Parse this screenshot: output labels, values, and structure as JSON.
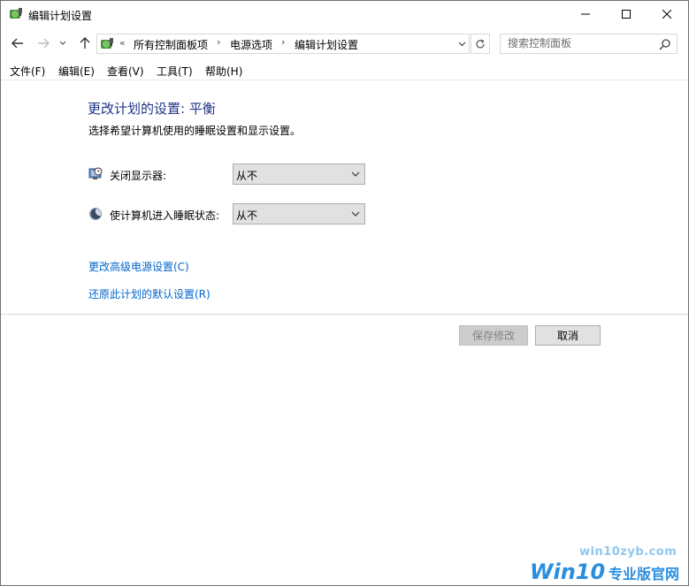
{
  "window": {
    "title": "编辑计划设置"
  },
  "address": {
    "overflow": "«",
    "crumbs": [
      "所有控制面板项",
      "电源选项",
      "编辑计划设置"
    ],
    "separator": "›"
  },
  "search": {
    "placeholder": "搜索控制面板"
  },
  "menu": {
    "file": "文件(F)",
    "edit": "编辑(E)",
    "view": "查看(V)",
    "tools": "工具(T)",
    "help": "帮助(H)"
  },
  "content": {
    "title": "更改计划的设置: 平衡",
    "description": "选择希望计算机使用的睡眠设置和显示设置。",
    "settings": [
      {
        "label": "关闭显示器:",
        "value": "从不",
        "icon": "monitor-clock-icon"
      },
      {
        "label": "使计算机进入睡眠状态:",
        "value": "从不",
        "icon": "moon-icon"
      }
    ],
    "links": {
      "advanced": "更改高级电源设置(C)",
      "restore": "还原此计划的默认设置(R)"
    }
  },
  "buttons": {
    "save": "保存修改",
    "cancel": "取消"
  },
  "watermark": {
    "url": "win10zyb.com",
    "brand": "Win10",
    "brand_sub": "专业版官网"
  },
  "colors": {
    "title_blue": "#1e3287",
    "link_blue": "#0066cc",
    "watermark_blue": "#2a8ee0"
  }
}
